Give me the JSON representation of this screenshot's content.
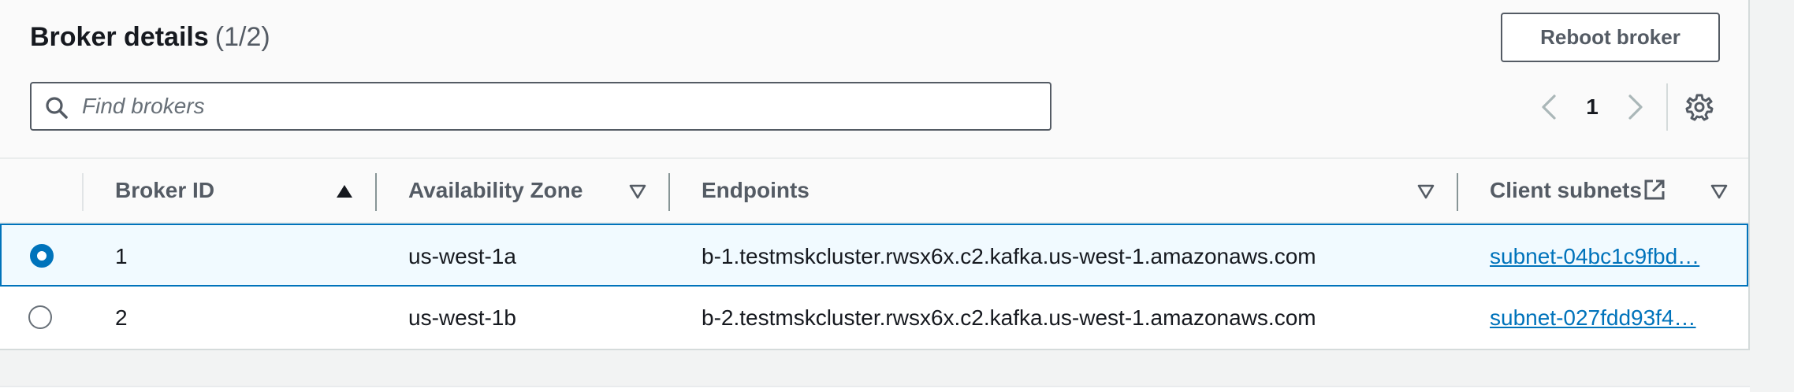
{
  "header": {
    "title": "Broker details",
    "count": "(1/2)",
    "reboot_label": "Reboot broker"
  },
  "search": {
    "placeholder": "Find brokers",
    "value": ""
  },
  "pagination": {
    "current_page": "1"
  },
  "table": {
    "columns": [
      {
        "label": "Broker ID",
        "sort": "ascending"
      },
      {
        "label": "Availability Zone",
        "sort": "none"
      },
      {
        "label": "Endpoints",
        "sort": "none"
      },
      {
        "label": "Client subnets",
        "sort": "none",
        "external_link_icon": "external-link-icon"
      }
    ],
    "rows": [
      {
        "selected": true,
        "broker_id": "1",
        "availability_zone": "us-west-1a",
        "endpoint": "b-1.testmskcluster.rwsx6x.c2.kafka.us-west-1.amazonaws.com",
        "client_subnet": "subnet-04bc1c9fbd…"
      },
      {
        "selected": false,
        "broker_id": "2",
        "availability_zone": "us-west-1b",
        "endpoint": "b-2.testmskcluster.rwsx6x.c2.kafka.us-west-1.amazonaws.com",
        "client_subnet": "subnet-027fdd93f4…"
      }
    ]
  },
  "colors": {
    "accent": "#0073bb",
    "text": "#16191f",
    "muted": "#545b64"
  }
}
